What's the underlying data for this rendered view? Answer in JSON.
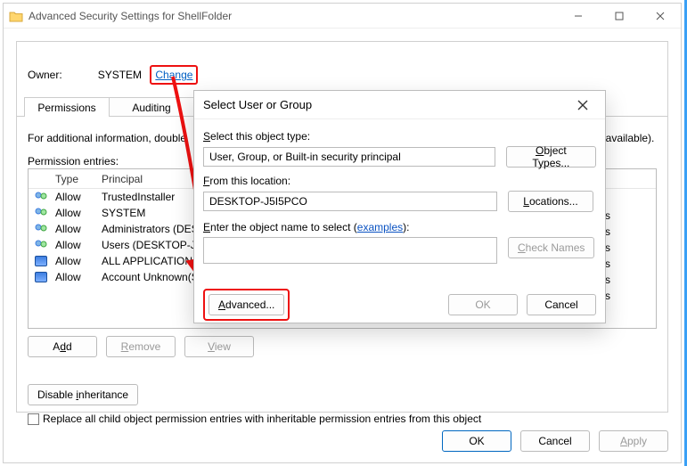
{
  "window": {
    "title": "Advanced Security Settings for ShellFolder"
  },
  "owner": {
    "label": "Owner:",
    "value": "SYSTEM",
    "change": "Change"
  },
  "tabs": {
    "permissions": "Permissions",
    "auditing": "Auditing"
  },
  "info_line": "For additional information, double",
  "entries_label": "Permission entries:",
  "columns": {
    "type": "Type",
    "principal": "Principal"
  },
  "rows": [
    {
      "type": "Allow",
      "principal": "TrustedInstaller",
      "kind": "users"
    },
    {
      "type": "Allow",
      "principal": "SYSTEM",
      "kind": "users"
    },
    {
      "type": "Allow",
      "principal": "Administrators (DES",
      "kind": "users"
    },
    {
      "type": "Allow",
      "principal": "Users (DESKTOP-J5I5",
      "kind": "users"
    },
    {
      "type": "Allow",
      "principal": "ALL APPLICATION PA",
      "kind": "app"
    },
    {
      "type": "Allow",
      "principal": "Account Unknown(S",
      "kind": "app"
    }
  ],
  "right_partial": {
    "available": "f available).",
    "ys": "ys"
  },
  "buttons": {
    "add": "Add",
    "remove": "Remove",
    "view": "View",
    "disable_inheritance": "Disable inheritance",
    "ok": "OK",
    "cancel": "Cancel",
    "apply": "Apply"
  },
  "replace_text": "Replace all child object permission entries with inheritable permission entries from this object",
  "dialog": {
    "title": "Select User or Group",
    "object_type_label": "Select this object type:",
    "object_type_value": "User, Group, or Built-in security principal",
    "object_types_btn": "Object Types...",
    "location_label": "From this location:",
    "location_value": "DESKTOP-J5I5PCO",
    "locations_btn": "Locations...",
    "enter_pre": "Enter the object name to select (",
    "enter_link": "examples",
    "enter_post": "):",
    "check_names": "Check Names",
    "advanced": "Advanced...",
    "ok": "OK",
    "cancel": "Cancel"
  }
}
